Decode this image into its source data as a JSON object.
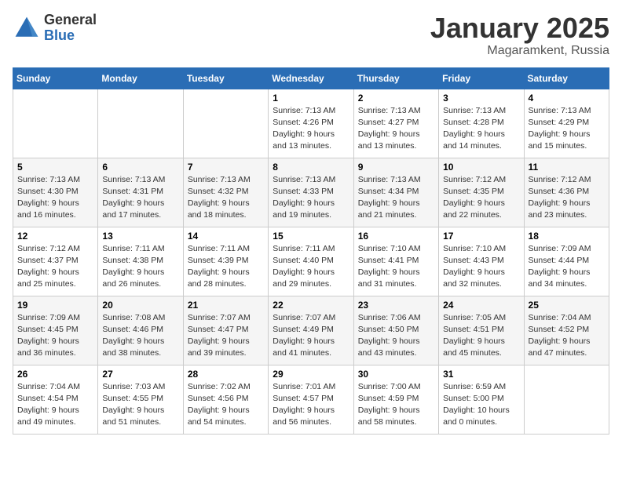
{
  "header": {
    "logo": {
      "general": "General",
      "blue": "Blue"
    },
    "title": "January 2025",
    "location": "Magaramkent, Russia"
  },
  "weekdays": [
    "Sunday",
    "Monday",
    "Tuesday",
    "Wednesday",
    "Thursday",
    "Friday",
    "Saturday"
  ],
  "weeks": [
    [
      {
        "day": "",
        "sunrise": "",
        "sunset": "",
        "daylight": ""
      },
      {
        "day": "",
        "sunrise": "",
        "sunset": "",
        "daylight": ""
      },
      {
        "day": "",
        "sunrise": "",
        "sunset": "",
        "daylight": ""
      },
      {
        "day": "1",
        "sunrise": "Sunrise: 7:13 AM",
        "sunset": "Sunset: 4:26 PM",
        "daylight": "Daylight: 9 hours and 13 minutes."
      },
      {
        "day": "2",
        "sunrise": "Sunrise: 7:13 AM",
        "sunset": "Sunset: 4:27 PM",
        "daylight": "Daylight: 9 hours and 13 minutes."
      },
      {
        "day": "3",
        "sunrise": "Sunrise: 7:13 AM",
        "sunset": "Sunset: 4:28 PM",
        "daylight": "Daylight: 9 hours and 14 minutes."
      },
      {
        "day": "4",
        "sunrise": "Sunrise: 7:13 AM",
        "sunset": "Sunset: 4:29 PM",
        "daylight": "Daylight: 9 hours and 15 minutes."
      }
    ],
    [
      {
        "day": "5",
        "sunrise": "Sunrise: 7:13 AM",
        "sunset": "Sunset: 4:30 PM",
        "daylight": "Daylight: 9 hours and 16 minutes."
      },
      {
        "day": "6",
        "sunrise": "Sunrise: 7:13 AM",
        "sunset": "Sunset: 4:31 PM",
        "daylight": "Daylight: 9 hours and 17 minutes."
      },
      {
        "day": "7",
        "sunrise": "Sunrise: 7:13 AM",
        "sunset": "Sunset: 4:32 PM",
        "daylight": "Daylight: 9 hours and 18 minutes."
      },
      {
        "day": "8",
        "sunrise": "Sunrise: 7:13 AM",
        "sunset": "Sunset: 4:33 PM",
        "daylight": "Daylight: 9 hours and 19 minutes."
      },
      {
        "day": "9",
        "sunrise": "Sunrise: 7:13 AM",
        "sunset": "Sunset: 4:34 PM",
        "daylight": "Daylight: 9 hours and 21 minutes."
      },
      {
        "day": "10",
        "sunrise": "Sunrise: 7:12 AM",
        "sunset": "Sunset: 4:35 PM",
        "daylight": "Daylight: 9 hours and 22 minutes."
      },
      {
        "day": "11",
        "sunrise": "Sunrise: 7:12 AM",
        "sunset": "Sunset: 4:36 PM",
        "daylight": "Daylight: 9 hours and 23 minutes."
      }
    ],
    [
      {
        "day": "12",
        "sunrise": "Sunrise: 7:12 AM",
        "sunset": "Sunset: 4:37 PM",
        "daylight": "Daylight: 9 hours and 25 minutes."
      },
      {
        "day": "13",
        "sunrise": "Sunrise: 7:11 AM",
        "sunset": "Sunset: 4:38 PM",
        "daylight": "Daylight: 9 hours and 26 minutes."
      },
      {
        "day": "14",
        "sunrise": "Sunrise: 7:11 AM",
        "sunset": "Sunset: 4:39 PM",
        "daylight": "Daylight: 9 hours and 28 minutes."
      },
      {
        "day": "15",
        "sunrise": "Sunrise: 7:11 AM",
        "sunset": "Sunset: 4:40 PM",
        "daylight": "Daylight: 9 hours and 29 minutes."
      },
      {
        "day": "16",
        "sunrise": "Sunrise: 7:10 AM",
        "sunset": "Sunset: 4:41 PM",
        "daylight": "Daylight: 9 hours and 31 minutes."
      },
      {
        "day": "17",
        "sunrise": "Sunrise: 7:10 AM",
        "sunset": "Sunset: 4:43 PM",
        "daylight": "Daylight: 9 hours and 32 minutes."
      },
      {
        "day": "18",
        "sunrise": "Sunrise: 7:09 AM",
        "sunset": "Sunset: 4:44 PM",
        "daylight": "Daylight: 9 hours and 34 minutes."
      }
    ],
    [
      {
        "day": "19",
        "sunrise": "Sunrise: 7:09 AM",
        "sunset": "Sunset: 4:45 PM",
        "daylight": "Daylight: 9 hours and 36 minutes."
      },
      {
        "day": "20",
        "sunrise": "Sunrise: 7:08 AM",
        "sunset": "Sunset: 4:46 PM",
        "daylight": "Daylight: 9 hours and 38 minutes."
      },
      {
        "day": "21",
        "sunrise": "Sunrise: 7:07 AM",
        "sunset": "Sunset: 4:47 PM",
        "daylight": "Daylight: 9 hours and 39 minutes."
      },
      {
        "day": "22",
        "sunrise": "Sunrise: 7:07 AM",
        "sunset": "Sunset: 4:49 PM",
        "daylight": "Daylight: 9 hours and 41 minutes."
      },
      {
        "day": "23",
        "sunrise": "Sunrise: 7:06 AM",
        "sunset": "Sunset: 4:50 PM",
        "daylight": "Daylight: 9 hours and 43 minutes."
      },
      {
        "day": "24",
        "sunrise": "Sunrise: 7:05 AM",
        "sunset": "Sunset: 4:51 PM",
        "daylight": "Daylight: 9 hours and 45 minutes."
      },
      {
        "day": "25",
        "sunrise": "Sunrise: 7:04 AM",
        "sunset": "Sunset: 4:52 PM",
        "daylight": "Daylight: 9 hours and 47 minutes."
      }
    ],
    [
      {
        "day": "26",
        "sunrise": "Sunrise: 7:04 AM",
        "sunset": "Sunset: 4:54 PM",
        "daylight": "Daylight: 9 hours and 49 minutes."
      },
      {
        "day": "27",
        "sunrise": "Sunrise: 7:03 AM",
        "sunset": "Sunset: 4:55 PM",
        "daylight": "Daylight: 9 hours and 51 minutes."
      },
      {
        "day": "28",
        "sunrise": "Sunrise: 7:02 AM",
        "sunset": "Sunset: 4:56 PM",
        "daylight": "Daylight: 9 hours and 54 minutes."
      },
      {
        "day": "29",
        "sunrise": "Sunrise: 7:01 AM",
        "sunset": "Sunset: 4:57 PM",
        "daylight": "Daylight: 9 hours and 56 minutes."
      },
      {
        "day": "30",
        "sunrise": "Sunrise: 7:00 AM",
        "sunset": "Sunset: 4:59 PM",
        "daylight": "Daylight: 9 hours and 58 minutes."
      },
      {
        "day": "31",
        "sunrise": "Sunrise: 6:59 AM",
        "sunset": "Sunset: 5:00 PM",
        "daylight": "Daylight: 10 hours and 0 minutes."
      },
      {
        "day": "",
        "sunrise": "",
        "sunset": "",
        "daylight": ""
      }
    ]
  ]
}
